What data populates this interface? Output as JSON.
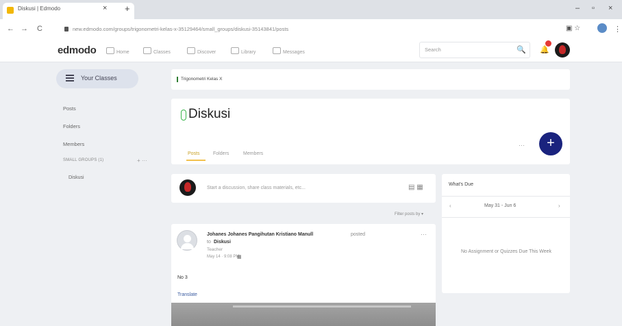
{
  "browser": {
    "tab_title": "Diskusi | Edmodo",
    "tab_close": "×",
    "new_tab": "+",
    "window_minimize": "–",
    "window_maximize": "▫",
    "window_close": "×",
    "back": "←",
    "forward": "→",
    "reload": "C",
    "url": "new.edmodo.com/groups/trigonometri-kelas-x-35129464/small_groups/diskusi-35143841/posts",
    "extensions": "▣  ☆",
    "menu": "⋮"
  },
  "topnav": {
    "logo": "edmodo",
    "links": [
      "Home",
      "Classes",
      "Discover",
      "Library",
      "Messages"
    ],
    "search_placeholder": "Search",
    "search_icon": "🔍",
    "notif_icon": "🔔"
  },
  "sidebar": {
    "your_classes": "Your Classes",
    "links": [
      "Posts",
      "Folders",
      "Members"
    ],
    "small_groups": "SMALL GROUPS (1)",
    "add": "+ ···",
    "group_item": "Diskusi"
  },
  "breadcrumb": "Trigonometri Kelas X",
  "group": {
    "title": "Diskusi",
    "tabs": [
      "Posts",
      "Folders",
      "Members"
    ],
    "more": "···",
    "fab": "+"
  },
  "composer": {
    "placeholder": "Start a discussion, share class materials, etc...",
    "icons": "▤ ▦"
  },
  "filter": "Filter posts by ▾",
  "post": {
    "author": "Johanes Johanes Pangihutan Kristiano Manull",
    "posted": "posted",
    "to": "to",
    "group": "Diskusi",
    "role": "Teacher",
    "date": "May 14 · 9:08 PM",
    "date_icon": "▦",
    "more": "···",
    "body": "No 3",
    "translate": "Translate"
  },
  "due": {
    "title": "What's Due",
    "prev": "‹",
    "range": "May 31 - Jun 6",
    "next": "›",
    "empty": "No Assignment or Quizzes Due This Week"
  }
}
